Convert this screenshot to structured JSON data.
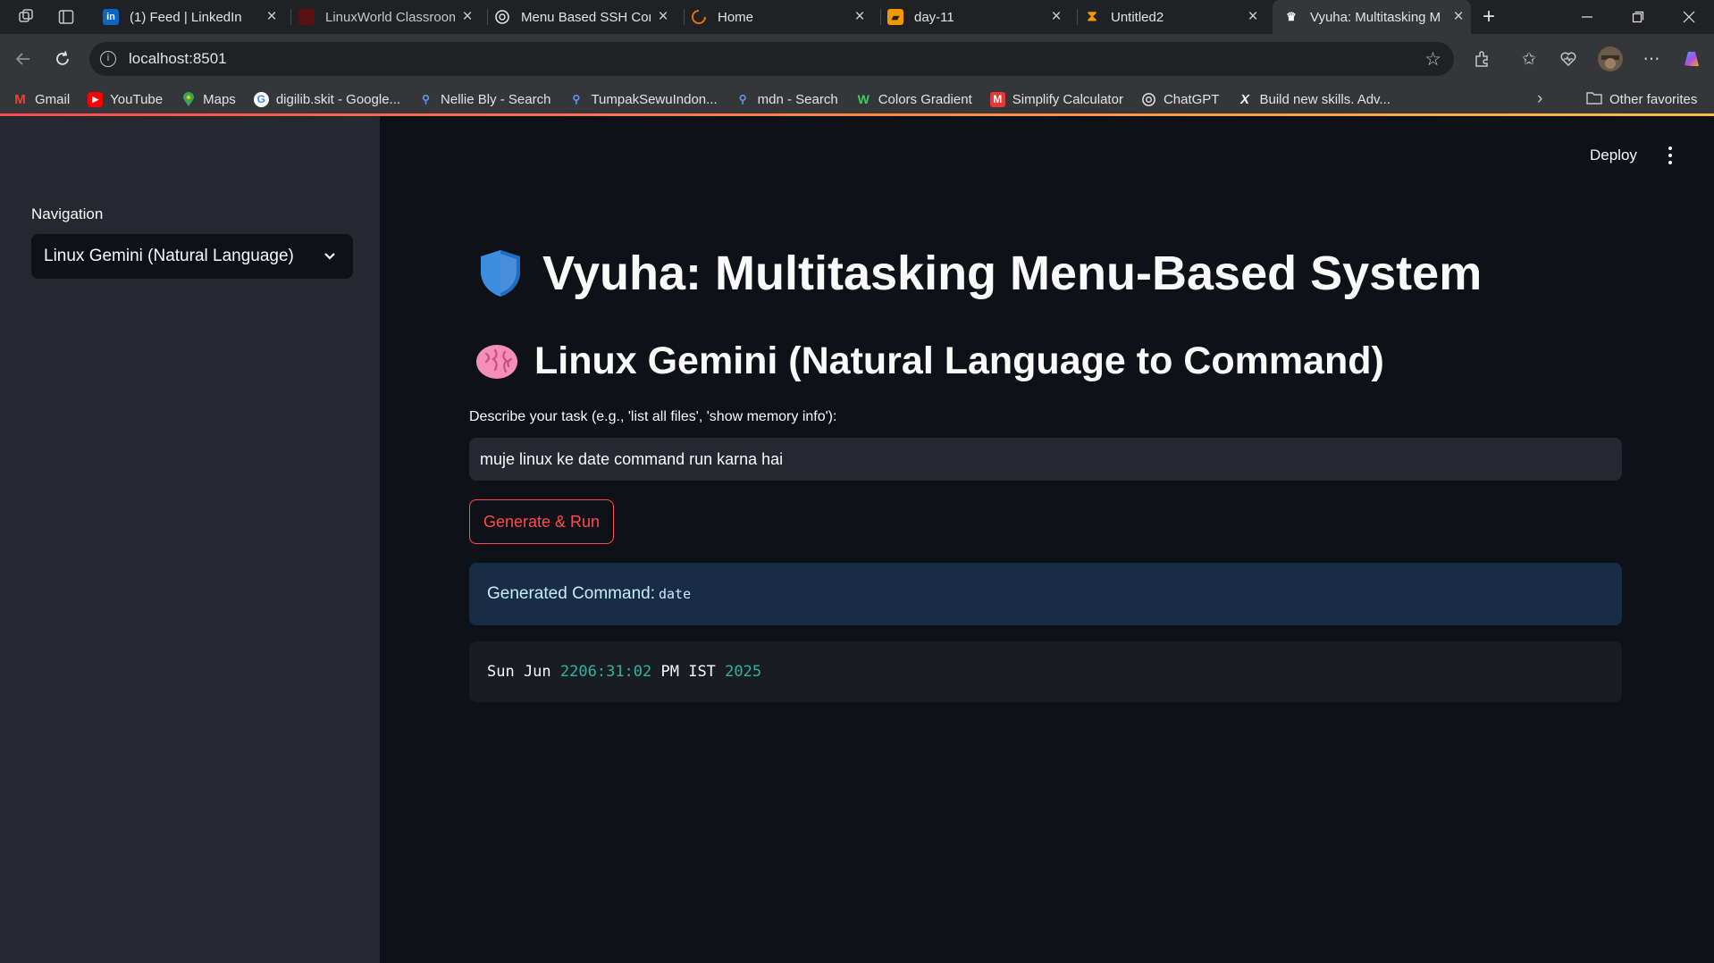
{
  "browser": {
    "tabs": [
      {
        "title": "(1) Feed | LinkedIn",
        "favicon": "linkedin-icon",
        "color": "#0a66c2"
      },
      {
        "title": "LinuxWorld Classroom",
        "favicon": "linuxworld-icon",
        "color": "#8b1a1a"
      },
      {
        "title": "Menu Based SSH Com",
        "favicon": "chatgpt-icon",
        "color": "#ffffff"
      },
      {
        "title": "Home",
        "favicon": "loading-icon",
        "color": "#e8710a"
      },
      {
        "title": "day-11",
        "favicon": "book-icon",
        "color": "#f29900"
      },
      {
        "title": "Untitled2",
        "favicon": "hourglass-icon",
        "color": "#f29900"
      },
      {
        "title": "Vyuha: Multitasking M",
        "favicon": "streamlit-icon",
        "color": "#ffffff"
      }
    ],
    "url": "localhost:8501",
    "bookmarks": [
      {
        "label": "Gmail",
        "icon": "gmail-icon",
        "color": "#ea4335"
      },
      {
        "label": "YouTube",
        "icon": "youtube-icon",
        "color": "#ff0000"
      },
      {
        "label": "Maps",
        "icon": "maps-icon",
        "color": "#34a853"
      },
      {
        "label": "digilib.skit - Google...",
        "icon": "google-icon",
        "color": "#4285f4"
      },
      {
        "label": "Nellie Bly - Search",
        "icon": "search-icon",
        "color": "#5b9bf8"
      },
      {
        "label": "TumpakSewuIndon...",
        "icon": "search-icon",
        "color": "#5b9bf8"
      },
      {
        "label": "mdn - Search",
        "icon": "search-icon",
        "color": "#5b9bf8"
      },
      {
        "label": "Colors Gradient",
        "icon": "gradient-icon",
        "color": "#3ccf60"
      },
      {
        "label": "Simplify Calculator",
        "icon": "calculator-icon",
        "color": "#e53935"
      },
      {
        "label": "ChatGPT",
        "icon": "chatgpt-icon",
        "color": "#ffffff"
      },
      {
        "label": "Build new skills. Adv...",
        "icon": "x-icon",
        "color": "#ffffff"
      }
    ],
    "other_favorites": "Other favorites"
  },
  "app": {
    "sidebar": {
      "label": "Navigation",
      "selected": "Linux Gemini (Natural Language)"
    },
    "header": {
      "deploy": "Deploy"
    },
    "title": "Vyuha: Multitasking Menu-Based System",
    "title_emoji": "shield-icon",
    "subtitle": "Linux Gemini (Natural Language to Command)",
    "subtitle_emoji": "brain-icon",
    "input_label": "Describe your task (e.g., 'list all files', 'show memory info'):",
    "input_value": "muje linux ke date command run karna hai",
    "button": "Generate & Run",
    "alert_prefix": "Generated Command:",
    "alert_code": "date",
    "output": {
      "p1": "Sun Jun ",
      "n1": "22",
      "n2": "06:31:02",
      "p2": " PM IST ",
      "n3": "2025"
    },
    "colors": {
      "accent": "#ff4b4b",
      "bg": "#0e1117",
      "sidebar": "#262730",
      "info_bg": "#172d43"
    }
  }
}
